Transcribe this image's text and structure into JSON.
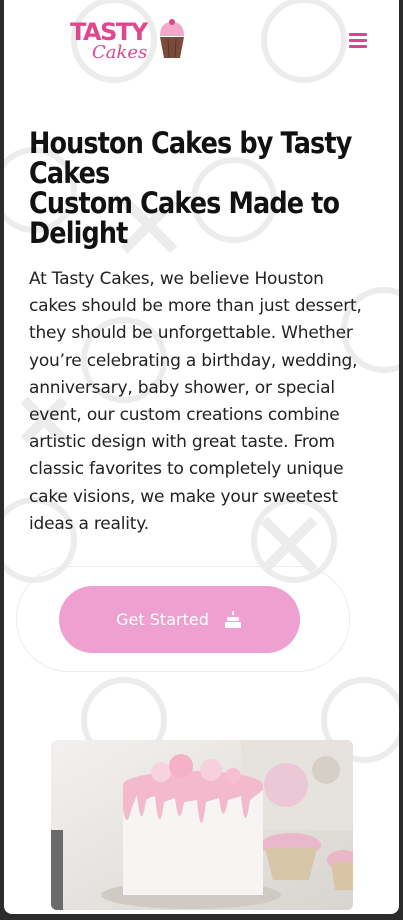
{
  "logo": {
    "line1": "TASTY",
    "line2": "Cakes"
  },
  "nav": {
    "menu_icon": "hamburger-menu-icon"
  },
  "hero": {
    "title_line1": "Houston Cakes by Tasty",
    "title_line2": "Cakes",
    "title_line3": "Custom Cakes Made to",
    "title_line4": "Delight",
    "body": "At Tasty Cakes, we believe Houston cakes should be more than just dessert, they should be unforgettable. Whether you’re celebrating a birthday, wedding, anniversary, baby shower, or special event, our custom creations combine artistic design with great taste. From classic favorites to completely unique cake visions, we make your sweetest ideas a reality.",
    "cta_label": "Get Started",
    "cta_icon": "birthday-cake-icon"
  },
  "colors": {
    "brand_pink": "#d9468c",
    "button_pink": "#eea0d0",
    "text": "#111111"
  }
}
